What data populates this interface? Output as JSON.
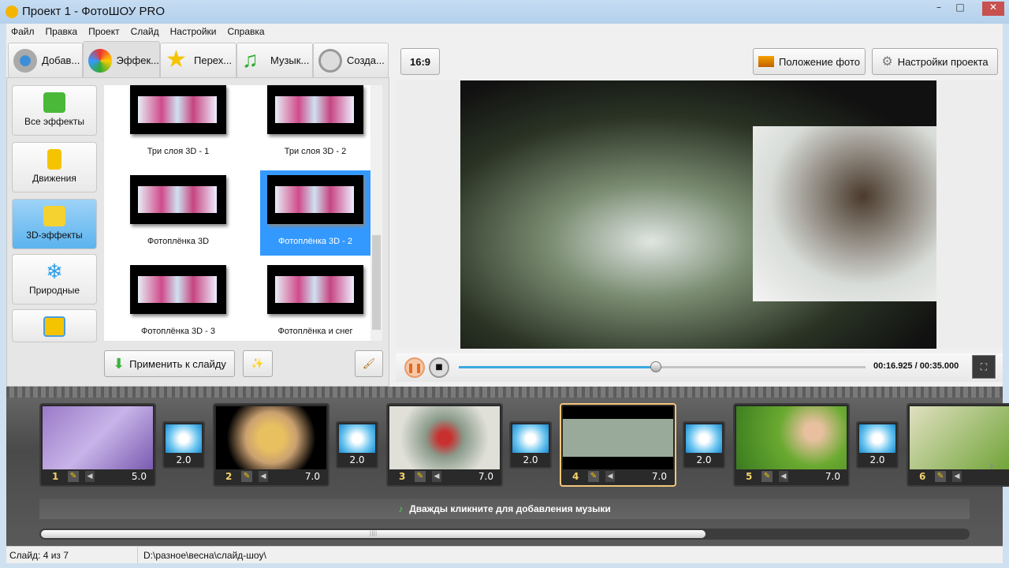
{
  "window": {
    "title": "Проект 1 - ФотоШОУ PRO",
    "minimize": "–",
    "maximize": "□",
    "close": "✕"
  },
  "menu": [
    "Файл",
    "Правка",
    "Проект",
    "Слайд",
    "Настройки",
    "Справка"
  ],
  "tabs": [
    {
      "label": "Добав...",
      "icon": "camera-icon"
    },
    {
      "label": "Эффек...",
      "icon": "palette-icon",
      "active": true
    },
    {
      "label": "Перех...",
      "icon": "star-icon"
    },
    {
      "label": "Музык...",
      "icon": "music-note-icon"
    },
    {
      "label": "Созда...",
      "icon": "film-reel-icon"
    }
  ],
  "categories": [
    {
      "label": "Все эффекты",
      "icon": "puzzle-icon"
    },
    {
      "label": "Движения",
      "icon": "move-arrows-icon"
    },
    {
      "label": "3D-эффекты",
      "icon": "cube-icon",
      "active": true
    },
    {
      "label": "Природные",
      "icon": "snowflake-icon"
    },
    {
      "label": "",
      "icon": "slides-icon"
    }
  ],
  "effects": [
    {
      "label": "Три слоя 3D - 1"
    },
    {
      "label": "Три слоя 3D - 2"
    },
    {
      "label": "Фотоплёнка 3D"
    },
    {
      "label": "Фотоплёнка 3D - 2",
      "selected": true
    },
    {
      "label": "Фотоплёнка 3D - 3"
    },
    {
      "label": "Фотоплёнка и снег"
    }
  ],
  "apply_button": "Применить к слайду",
  "preview": {
    "aspect": "16:9",
    "photo_position": "Положение фото",
    "project_settings": "Настройки проекта",
    "time": "00:16.925 / 00:35.000",
    "progress": 0.4836
  },
  "slides": [
    {
      "num": "1",
      "dur": "5.0"
    },
    {
      "num": "2",
      "dur": "7.0"
    },
    {
      "num": "3",
      "dur": "7.0"
    },
    {
      "num": "4",
      "dur": "7.0",
      "selected": true
    },
    {
      "num": "5",
      "dur": "7.0"
    },
    {
      "num": "6",
      "dur": ""
    }
  ],
  "transitions": [
    "2.0",
    "2.0",
    "2.0",
    "2.0",
    "2.0"
  ],
  "music_hint": "Дважды кликните для добавления музыки",
  "status": {
    "slide": "Слайд: 4 из 7",
    "path": "D:\\разное\\весна\\слайд-шоу\\"
  },
  "colors": {
    "accent": "#3399ff",
    "progress": "#3aa8e0",
    "selected_slide": "#f3c67c"
  }
}
